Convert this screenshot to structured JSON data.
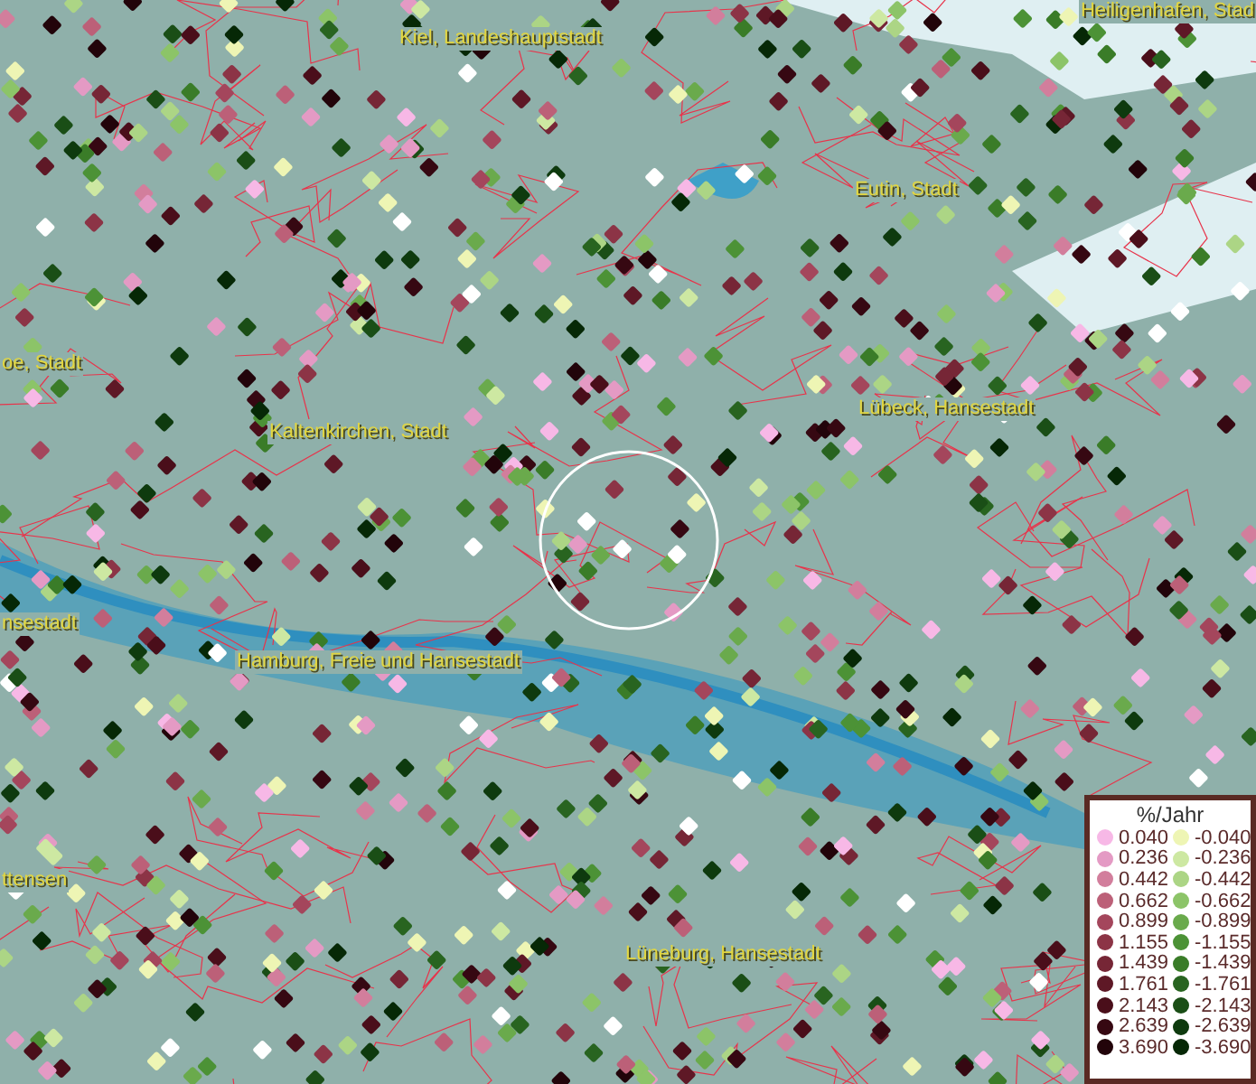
{
  "map": {
    "place_labels": [
      "Heiligenhafen, Stad",
      "Kiel, Landeshauptstadt",
      "Eutin, Stadt",
      "oe, Stadt",
      "Lübeck, Hansestadt",
      "Kaltenkirchen, Stadt",
      "nsestadt",
      "Hamburg, Freie und Hansestadt",
      "ttensen",
      "Lüneburg, Hansestadt"
    ]
  },
  "legend": {
    "title": "%/Jahr",
    "items": [
      {
        "label": "0.040",
        "color": "#f7b8e6"
      },
      {
        "label": "-0.040",
        "color": "#eef5b4"
      },
      {
        "label": "0.236",
        "color": "#e49ac4"
      },
      {
        "label": "-0.236",
        "color": "#cde8a2"
      },
      {
        "label": "0.442",
        "color": "#d27e9c"
      },
      {
        "label": "-0.442",
        "color": "#acd585"
      },
      {
        "label": "0.662",
        "color": "#bc6078"
      },
      {
        "label": "-0.662",
        "color": "#8cc468"
      },
      {
        "label": "0.899",
        "color": "#a4465c"
      },
      {
        "label": "-0.899",
        "color": "#6aaa4c"
      },
      {
        "label": "1.155",
        "color": "#8c3446"
      },
      {
        "label": "-1.155",
        "color": "#4c9236"
      },
      {
        "label": "1.439",
        "color": "#762636"
      },
      {
        "label": "-1.439",
        "color": "#3a7c28"
      },
      {
        "label": "1.761",
        "color": "#5e1826"
      },
      {
        "label": "-1.761",
        "color": "#286420"
      },
      {
        "label": "2.143",
        "color": "#4a0e1a"
      },
      {
        "label": "-2.143",
        "color": "#1a4e16"
      },
      {
        "label": "2.639",
        "color": "#360812"
      },
      {
        "label": "-2.639",
        "color": "#0e3a0e"
      },
      {
        "label": "3.690",
        "color": "#22040a"
      },
      {
        "label": "-3.690",
        "color": "#062806"
      }
    ]
  }
}
